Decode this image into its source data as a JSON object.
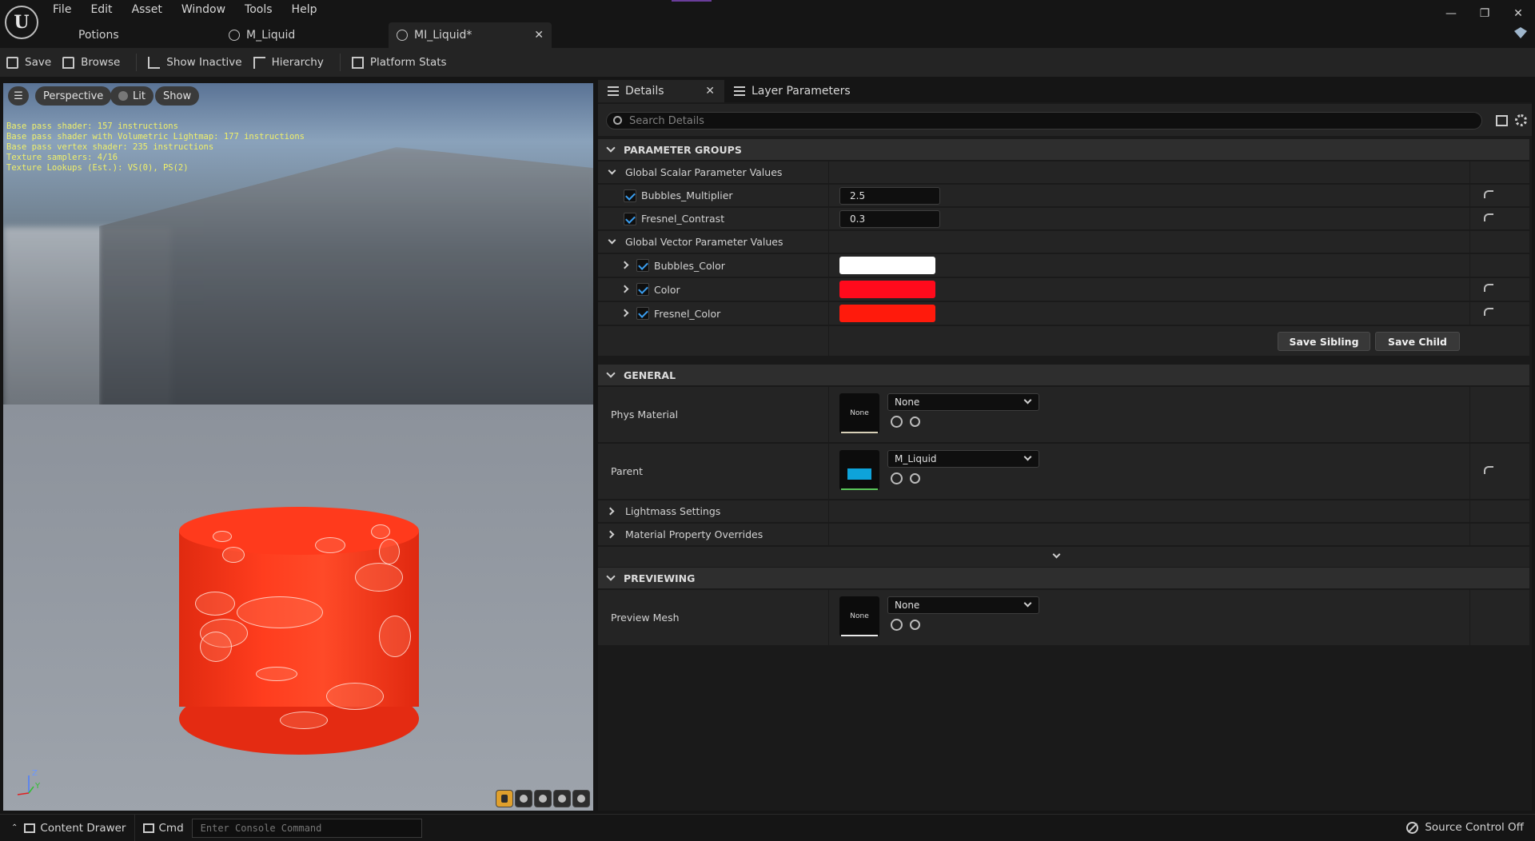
{
  "menu": [
    "File",
    "Edit",
    "Asset",
    "Window",
    "Tools",
    "Help"
  ],
  "window_controls": {
    "minimize": "—",
    "restore": "❐",
    "close": "✕"
  },
  "tabs": {
    "project": "Potions",
    "m_liquid": "M_Liquid",
    "mi_liquid": "MI_Liquid*",
    "close_glyph": "✕"
  },
  "toolbar": {
    "save": "Save",
    "browse": "Browse",
    "show_inactive": "Show Inactive",
    "hierarchy": "Hierarchy",
    "platform_stats": "Platform Stats"
  },
  "viewport": {
    "perspective": "Perspective",
    "lit": "Lit",
    "show": "Show",
    "stats": [
      "Base pass shader: 157 instructions",
      "Base pass shader with Volumetric Lightmap: 177 instructions",
      "Base pass vertex shader: 235 instructions",
      "Texture samplers: 4/16",
      "Texture Lookups (Est.): VS(0), PS(2)"
    ],
    "axis_z": "Z",
    "axis_y": "Y"
  },
  "details": {
    "tab_label": "Details",
    "layer_tab_label": "Layer Parameters",
    "search_placeholder": "Search Details",
    "sections": {
      "parameter_groups": "PARAMETER GROUPS",
      "general": "GENERAL",
      "previewing": "PREVIEWING"
    },
    "scalar_group": "Global Scalar Parameter Values",
    "scalar_params": [
      {
        "name": "Bubbles_Multiplier",
        "value": "2.5"
      },
      {
        "name": "Fresnel_Contrast",
        "value": "0.3"
      }
    ],
    "vector_group": "Global Vector Parameter Values",
    "vector_params": [
      {
        "name": "Bubbles_Color",
        "color": "#ffffff"
      },
      {
        "name": "Color",
        "color": "#ff0a1c"
      },
      {
        "name": "Fresnel_Color",
        "color": "#ff1a0c"
      }
    ],
    "save_sibling": "Save Sibling",
    "save_child": "Save Child",
    "phys_material": {
      "label": "Phys Material",
      "thumb": "None",
      "value": "None"
    },
    "parent": {
      "label": "Parent",
      "value": "M_Liquid"
    },
    "lightmass": "Lightmass Settings",
    "material_overrides": "Material Property Overrides",
    "preview_mesh": {
      "label": "Preview Mesh",
      "thumb": "None",
      "value": "None"
    }
  },
  "statusbar": {
    "content_drawer": "Content Drawer",
    "cmd": "Cmd",
    "console_placeholder": "Enter Console Command",
    "source_control": "Source Control Off"
  }
}
